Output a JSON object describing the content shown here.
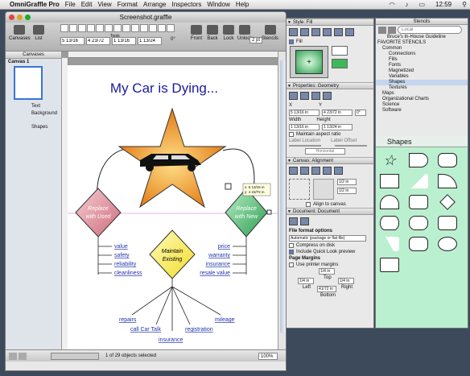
{
  "menubar": {
    "apple_icon": "apple-icon",
    "app": "OmniGraffle Pro",
    "items": [
      "File",
      "Edit",
      "View",
      "Format",
      "Arrange",
      "Inspectors",
      "Window",
      "Help"
    ],
    "clock": "12:59"
  },
  "window": {
    "title": "Screenshot.graffle",
    "toolbar": {
      "canvases": "Canvases",
      "list": "List",
      "tools": "Tools",
      "front": "Front",
      "back": "Back",
      "lock": "Lock",
      "unlock": "Unlock",
      "stencils": "Stencils",
      "x": "5 13/16",
      "y": "4 23/72",
      "w": "1 13/16",
      "h": "1 13/24",
      "angle": "0°",
      "stroke": "2 pt"
    },
    "sidebar": {
      "header": "Canvases",
      "canvas_name": "Canvas 1",
      "layers": [
        "Text",
        "Background",
        "Shapes"
      ]
    },
    "diagram": {
      "title": "My Car is Dying...",
      "replace_used": [
        "Replace",
        "with Used"
      ],
      "replace_new": [
        "Replace",
        "with New"
      ],
      "maintain": [
        "Maintain",
        "Existing"
      ],
      "left_list": [
        "value",
        "safety",
        "reliability",
        "cleanliness"
      ],
      "right_list": [
        "price",
        "warranty",
        "insurance",
        "resale value"
      ],
      "bottom_list": [
        "repairs",
        "call Car Talk",
        "insurance",
        "registration",
        "mileage"
      ],
      "tooltip": [
        "x: 5 13/16 in",
        "y: 4 23/72 in"
      ]
    },
    "status": {
      "selection": "1 of 29 objects selected",
      "zoom": "100%"
    }
  },
  "inspector": {
    "style_fill": "Style: Fill",
    "fill_label": "Fill",
    "geometry": "Properties: Geometry",
    "x_label": "X",
    "x": "5 13/16 in",
    "y_label": "Y",
    "y": "4 23/72 in",
    "width_label": "Width",
    "width": "1 13/16 in",
    "height_label": "Height",
    "height": "1 13/24 in",
    "angle": "0°",
    "maintain_aspect": "Maintain aspect ratio",
    "label_location": "Label Location",
    "label_offset": "Label Offset",
    "horizontal": "Horizontal",
    "alignment": "Canvas: Alignment",
    "align_val1": "1/2 in",
    "align_val2": "1/2 in",
    "align_to_canvas": "Align to canvas",
    "document": "Document: Document",
    "file_format_options": "File format options",
    "file_format": "Automatic (package or flat file)",
    "compress": "Compress on disk",
    "quicklook": "Include Quick Look preview",
    "page_margins": "Page Margins",
    "printer_margins": "Use printer margins",
    "top": "1/4 in",
    "top_label": "Top",
    "left": "1/4 in",
    "left_label": "Left",
    "right": "1/4 in",
    "right_label": "Right",
    "bottom": "41/72 in",
    "bottom_label": "Bottom"
  },
  "stencils": {
    "title": "Stencils",
    "search_placeholder": "Local",
    "tree": [
      {
        "label": "Bruce's In-House Guideline",
        "indent": 14
      },
      {
        "label": "FAVORITE STENCILS",
        "indent": 2
      },
      {
        "label": "Common",
        "indent": 8
      },
      {
        "label": "Connections",
        "indent": 16
      },
      {
        "label": "Fills",
        "indent": 16
      },
      {
        "label": "Fonts",
        "indent": 16
      },
      {
        "label": "Magnetized",
        "indent": 16
      },
      {
        "label": "Variables",
        "indent": 16
      },
      {
        "label": "Shapes",
        "indent": 16
      },
      {
        "label": "Textures",
        "indent": 16
      },
      {
        "label": "Maps",
        "indent": 8
      },
      {
        "label": "Organizational Charts",
        "indent": 8
      },
      {
        "label": "Science",
        "indent": 8
      },
      {
        "label": "Software",
        "indent": 8
      }
    ],
    "shapes_title": "Shapes"
  },
  "colors": {
    "title_blue": "#1a1a9c",
    "link_blue": "#2233aa",
    "diamond_red": "#e7a0a8",
    "diamond_green": "#6fcf8f",
    "diamond_yellow": "#fff466",
    "star_orange": "#f5a623",
    "fill_green": "#3fb858",
    "shapes_bg": "#baf0d0"
  }
}
